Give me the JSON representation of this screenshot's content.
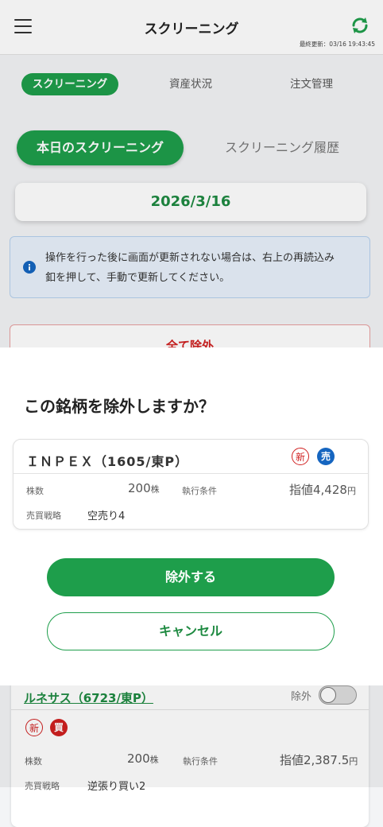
{
  "header": {
    "title": "スクリーニング",
    "last_updated": "最終更新：03/16 19:43:45",
    "icons": [
      "menu-icon",
      "refresh-icon"
    ]
  },
  "tabs": [
    {
      "label": "スクリーニング",
      "active": true
    },
    {
      "label": "資産状況",
      "active": false
    },
    {
      "label": "注文管理",
      "active": false
    }
  ],
  "subtabs": [
    {
      "label": "本日のスクリーニング",
      "active": true
    },
    {
      "label": "スクリーニング履歴",
      "active": false
    }
  ],
  "date": "2026/3/16",
  "notice": {
    "line1": "操作を行った後に画面が更新されない場合は、右上の再読込み",
    "line2": "釦を押して、手動で更新してください。"
  },
  "remove_all_label": "全て除外",
  "modal": {
    "question": "この銘柄を除外しますか？",
    "stock": {
      "name": "ＩＮＰＥＸ（1605/東P）",
      "badges": [
        "新",
        "売"
      ],
      "shares_label": "株数",
      "shares_value": "200",
      "shares_unit": "株",
      "condition_label": "執行条件",
      "condition_value": "指値4,428",
      "condition_unit": "円",
      "strategy_label": "売買戦略",
      "strategy_value": "空売り4"
    },
    "confirm_label": "除外する",
    "cancel_label": "キャンセル"
  },
  "background_card": {
    "name": "ルネサス（6723/東P）",
    "exclude_label": "除外",
    "badges": [
      "新",
      "買"
    ],
    "shares_label": "株数",
    "shares_value": "200",
    "shares_unit": "株",
    "condition_label": "執行条件",
    "condition_value": "指値2,387.5",
    "condition_unit": "円",
    "strategy_label": "売買戦略",
    "strategy_value": "逆張り買い2"
  },
  "colors": {
    "primary_green": "#1e9e4b",
    "danger_red": "#d02020",
    "sell_blue": "#1565c0",
    "info_blue": "#1565c0"
  }
}
